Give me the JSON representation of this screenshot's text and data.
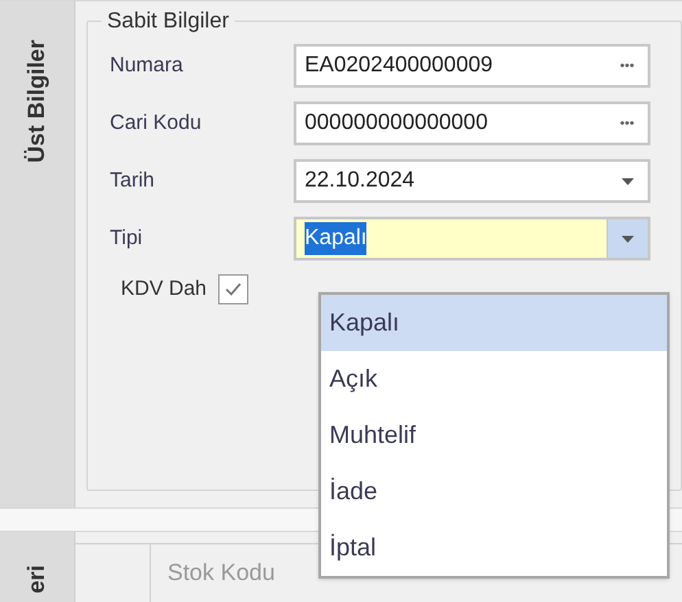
{
  "side_tabs": [
    {
      "label": "Üst Bilgiler"
    },
    {
      "label": "eri"
    }
  ],
  "group": {
    "title": "Sabit Bilgiler"
  },
  "fields": [
    {
      "label": "Numara",
      "kind": "lookup",
      "value": "EA0202400000009",
      "button": "•••",
      "focused": false
    },
    {
      "label": "Cari Kodu",
      "kind": "lookup",
      "value": "000000000000000",
      "button": "•••",
      "focused": false
    },
    {
      "label": "Tarih",
      "kind": "combo",
      "value": "22.10.2024",
      "focused": false
    },
    {
      "label": "Tipi",
      "kind": "combo",
      "value": "Kapalı",
      "focused": true
    }
  ],
  "checkbox": {
    "label": "KDV Dah",
    "checked": true
  },
  "dropdown": {
    "open": true,
    "items": [
      {
        "label": "Kapalı",
        "selected": true
      },
      {
        "label": "Açık",
        "selected": false
      },
      {
        "label": "Muhtelif",
        "selected": false
      },
      {
        "label": "İade",
        "selected": false
      },
      {
        "label": "İptal",
        "selected": false
      }
    ]
  },
  "grid": {
    "columns": [
      "Stok Kodu"
    ]
  }
}
